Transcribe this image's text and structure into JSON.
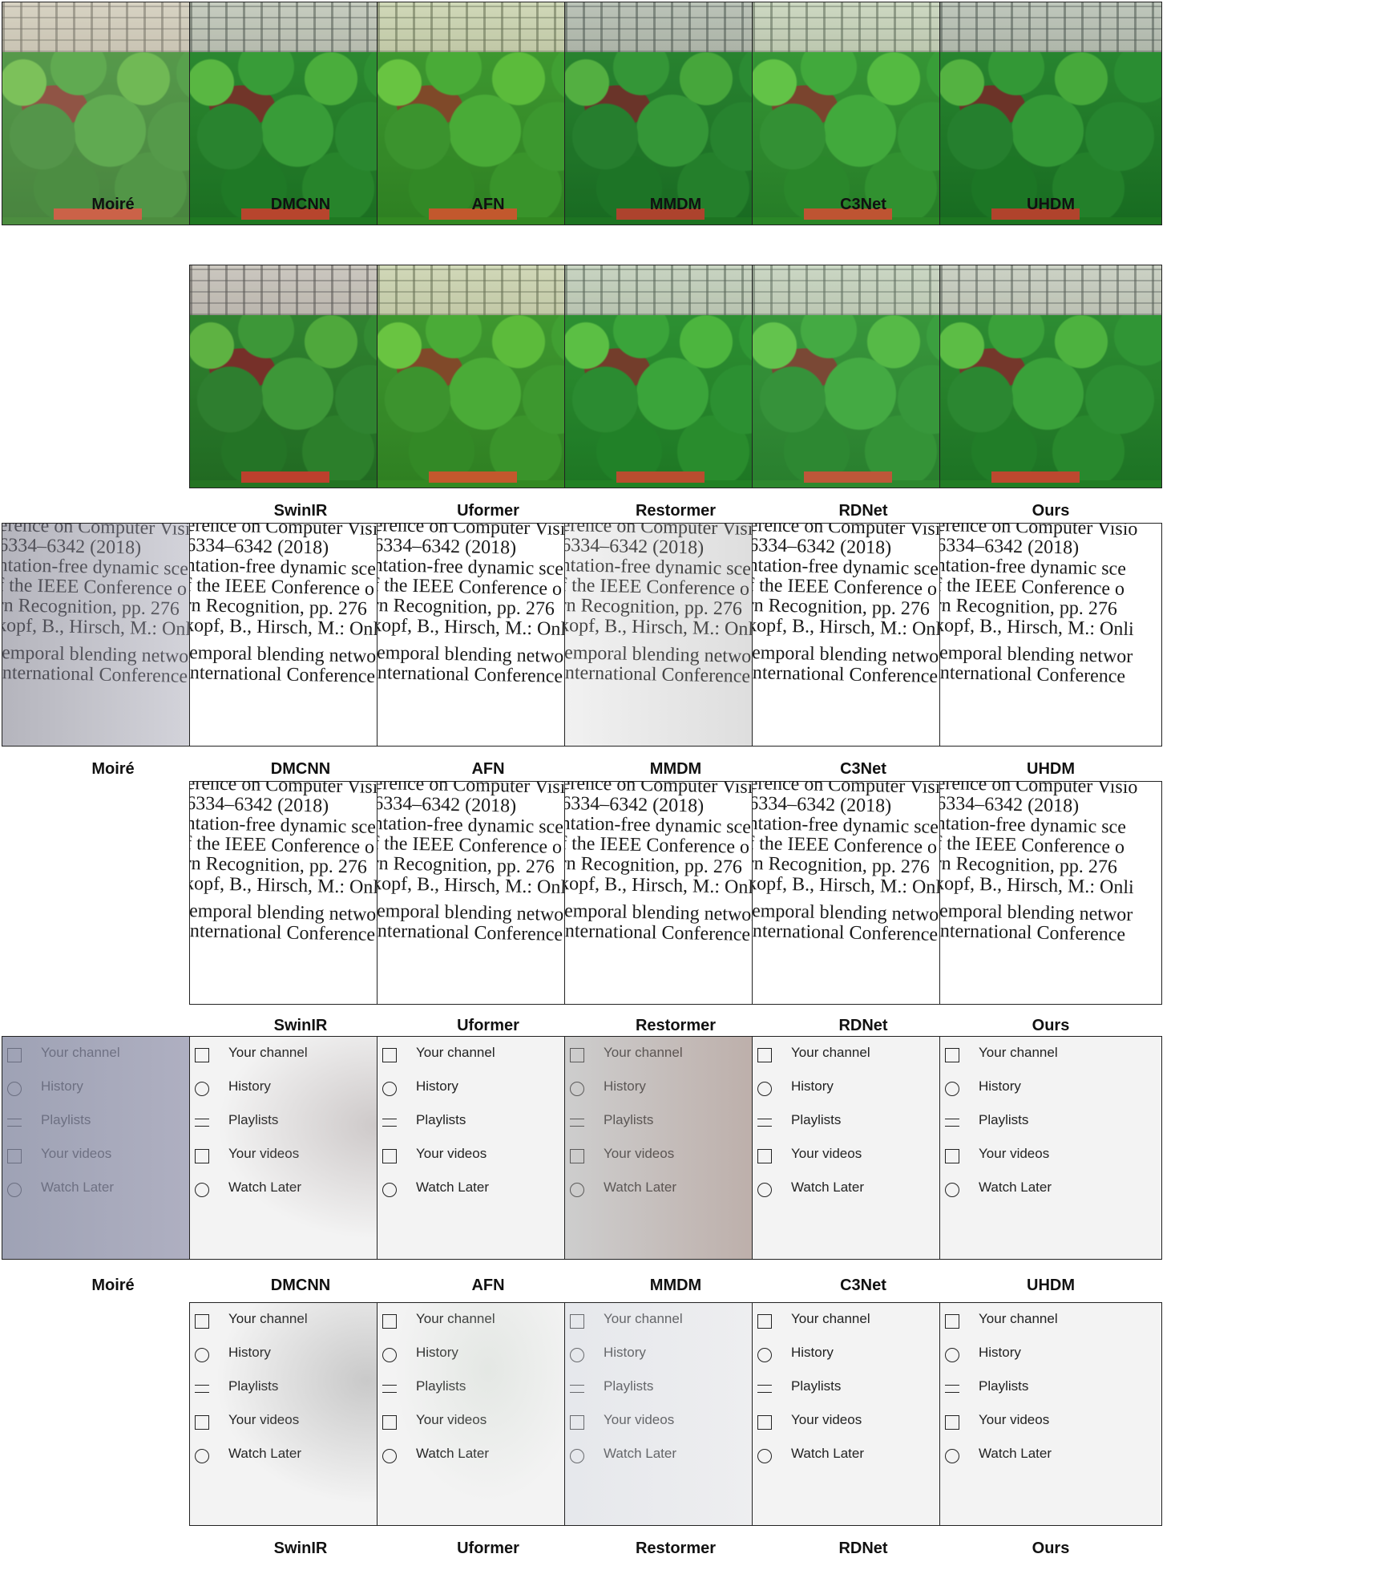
{
  "captions": {
    "moire": "Moiré",
    "dmcnn": "DMCNN",
    "afn": "AFN",
    "mmdm": "MMDM",
    "c3net": "C3Net",
    "uhdm": "UHDM",
    "swinir": "SwinIR",
    "uformer": "Uformer",
    "restormer": "Restormer",
    "rdnet": "RDNet",
    "ours": "Ours"
  },
  "document_text": {
    "line1": "erence on Computer Visio",
    "line2": "6334–6342 (2018)",
    "line3": "ntation-free dynamic sce",
    "line4": "f the IEEE Conference o",
    "line5": "rn Recognition, pp. 276",
    "line6": "kopf, B., Hirsch, M.: Onli",
    "line7": "temporal blending networ",
    "line8": "International Conference"
  },
  "menu": {
    "items": [
      "Your channel",
      "History",
      "Playlists",
      "Your videos",
      "Watch Later"
    ]
  }
}
